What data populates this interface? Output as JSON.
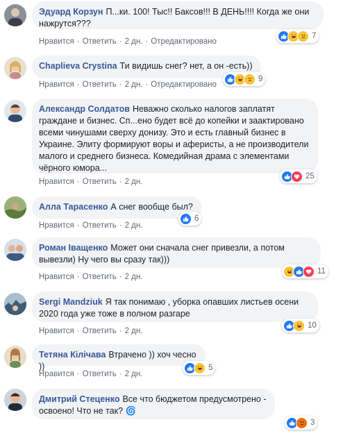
{
  "actions": {
    "like": "Нравится",
    "reply": "Ответить",
    "sep": "·",
    "time": "2 дн.",
    "edited": "Отредактировано"
  },
  "comments": [
    {
      "author": "Эдуард Корзун",
      "text": "П...ки. 100! Тыс!! Баксов!!! В ДЕНЬ!!!! Когда же они нажрутся???",
      "count": "7",
      "reactions": [
        "like",
        "haha",
        "sad"
      ],
      "edited": true
    },
    {
      "author": "Chaplieva Crystina",
      "text": "Ти видишь снег? нет, а он -есть))",
      "count": "9",
      "reactions": [
        "like",
        "haha",
        "sad"
      ],
      "edited": true
    },
    {
      "author": "Александр Солдатов",
      "text": "Неважно сколько налогов заплатят граждане и бизнес. Сп...ено будет всё до копейки и заактировано всеми чинушами сверху донизу. Это и есть главный бизнес в Украине. Элиту формируют воры и аферисты, а не производители малого и среднего бизнеса. Комедийная драма с элементами чёрного юмора...",
      "count": "25",
      "reactions": [
        "like",
        "love"
      ],
      "edited": false
    },
    {
      "author": "Алла Тарасенко",
      "text": "А снег вообще был?",
      "count": "6",
      "reactions": [
        "like"
      ],
      "edited": false
    },
    {
      "author": "Роман Іващенко",
      "text": "Может они сначала снег привезли, а потом вывезли) Ну чего вы сразу так)))",
      "count": "11",
      "reactions": [
        "haha",
        "like",
        "love"
      ],
      "edited": false
    },
    {
      "author": "Sergi Mandziuk",
      "text": "Я так понимаю , уборка опавших листьев осени 2020 года уже тоже в полном разгаре",
      "count": "10",
      "reactions": [
        "like",
        "haha"
      ],
      "edited": false
    },
    {
      "author": "Тетяна Кілічава",
      "text": "Втрачено )) хоч чесно ))",
      "count": "5",
      "reactions": [
        "like",
        "haha"
      ],
      "edited": false
    },
    {
      "author": "Дмитрий Стеценко",
      "text": "Все что бюджетом предусмотрено - освоено! Что не так? 🌀",
      "count": "3",
      "reactions": [
        "like",
        "angry"
      ],
      "edited": false
    }
  ],
  "colors": {
    "link": "#385898",
    "bubble": "#f2f3f5",
    "meta": "#606770"
  }
}
